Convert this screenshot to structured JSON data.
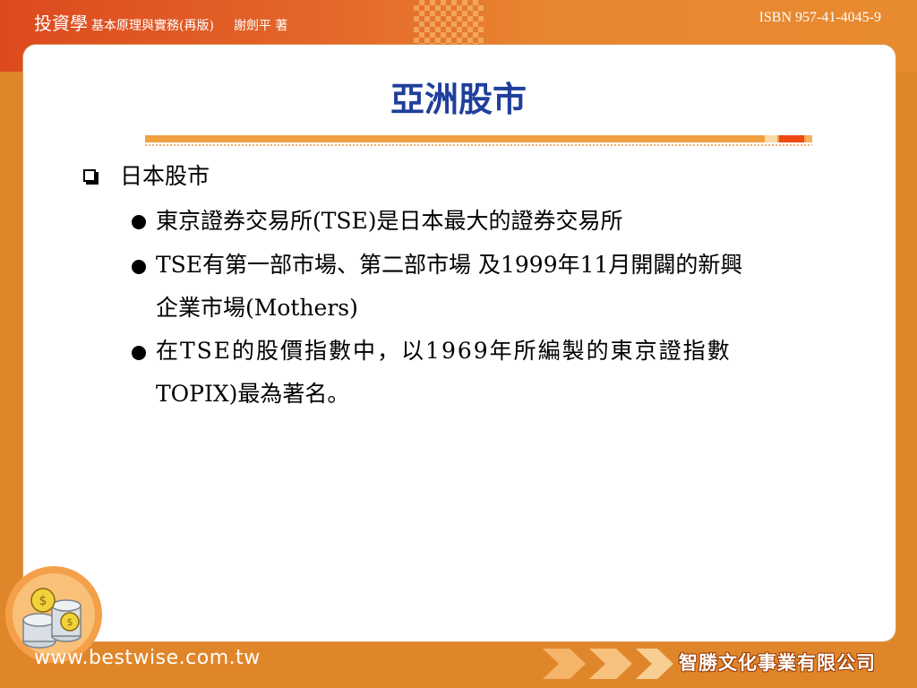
{
  "header": {
    "brand": "投資學",
    "subtitle": "基本原理與實務(再版)",
    "author": "謝劍平 著",
    "isbn": "ISBN 957-41-4045-9"
  },
  "slide": {
    "title": "亞洲股市",
    "heading": "日本股市",
    "bullets": [
      "東京證券交易所(TSE)是日本最大的證券交易所",
      "TSE有第一部市場、第二部市場 及1999年11月開闢的新興",
      "企業市場(Mothers)",
      "在TSE的股價指數中，以1969年所編製的東京證指數",
      "TOPIX)最為著名。"
    ]
  },
  "footer": {
    "website": "www.bestwise.com.tw",
    "company": "智勝文化事業有限公司"
  },
  "colors": {
    "title": "#1f3f9b",
    "frame": "#e0862a",
    "header_band": "#dc4a1e",
    "rule": "#f0a040",
    "rule_accent": "#ee4a16"
  },
  "icons": [
    "coin-stack-logo-icon",
    "checkbox-bullet-icon",
    "round-bullet-icon",
    "double-arrow-icon"
  ]
}
